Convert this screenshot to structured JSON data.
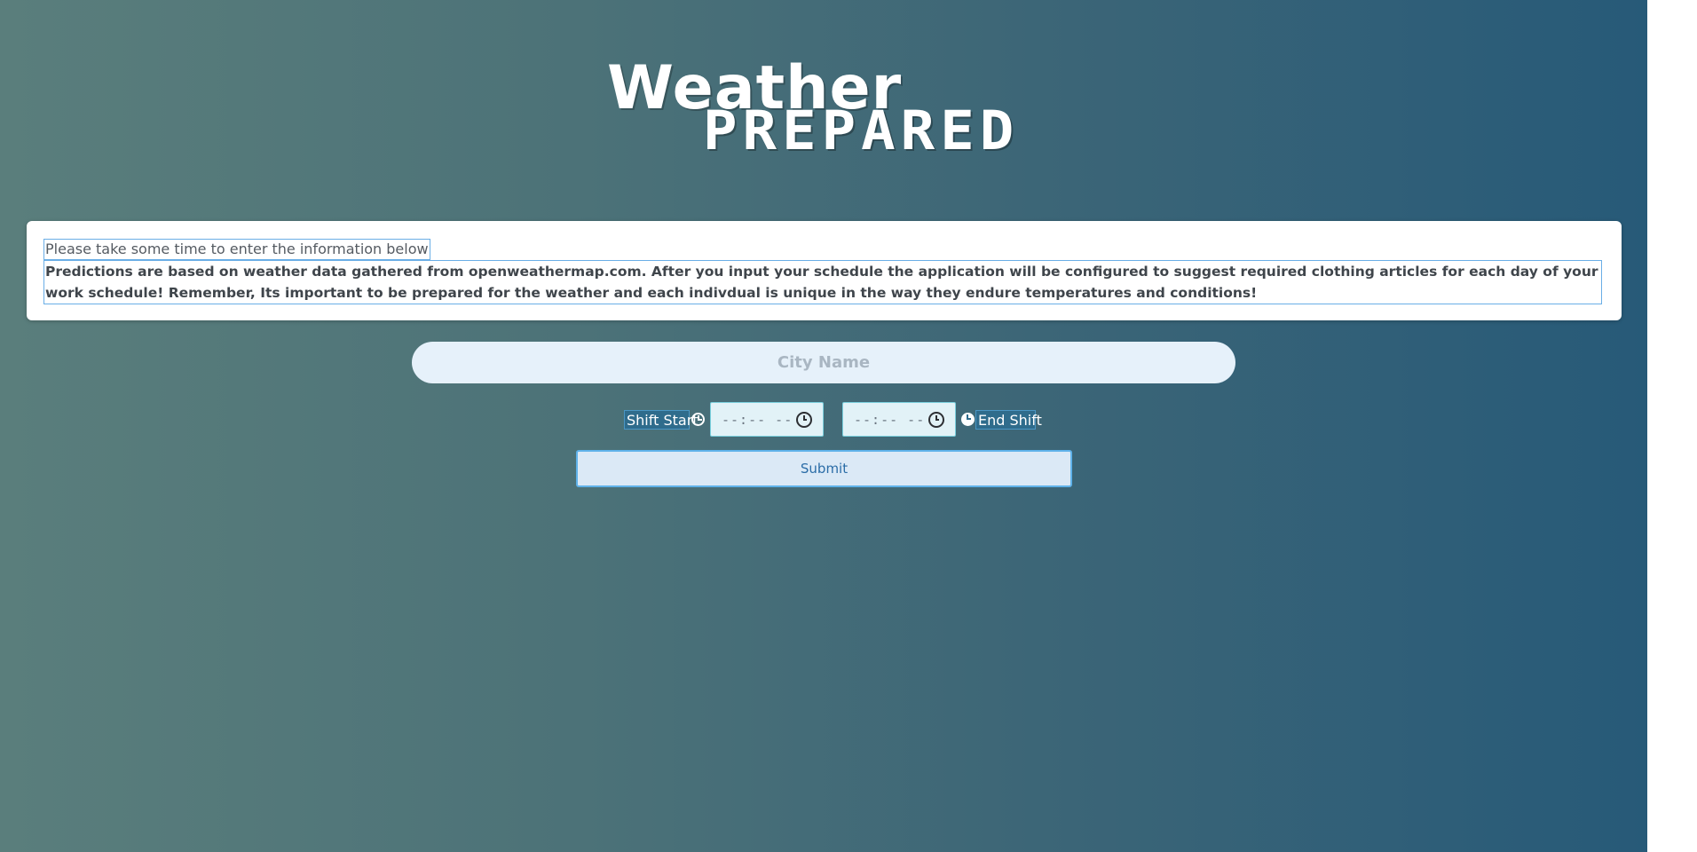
{
  "logo": {
    "line1": "Weather",
    "line2": "PREPARED"
  },
  "info": {
    "intro": "Please take some time to enter the information below",
    "body": "Predictions are based on weather data gathered from openweathermap.com. After you input your schedule the application will be configured to suggest required clothing articles for each day of your work schedule! Remember, Its important to be prepared for the weather and each indivdual is unique in the way they endure temperatures and conditions!"
  },
  "city": {
    "placeholder": "City Name",
    "value": ""
  },
  "shift": {
    "start_label": "Shift Start",
    "start_value": "--:-- --",
    "end_value": "--:-- --",
    "end_label": "End Shift",
    "start_icon": "clock-outline-icon",
    "end_icon": "clock-solid-icon"
  },
  "submit": {
    "label": "Submit"
  },
  "colors": {
    "gradient_start": "#5a7e7c",
    "gradient_end": "#275a78",
    "card_background": "#ffffff",
    "input_background": "#e6f1fa",
    "button_border": "#5fb2ea",
    "button_text": "#2b6da7"
  }
}
